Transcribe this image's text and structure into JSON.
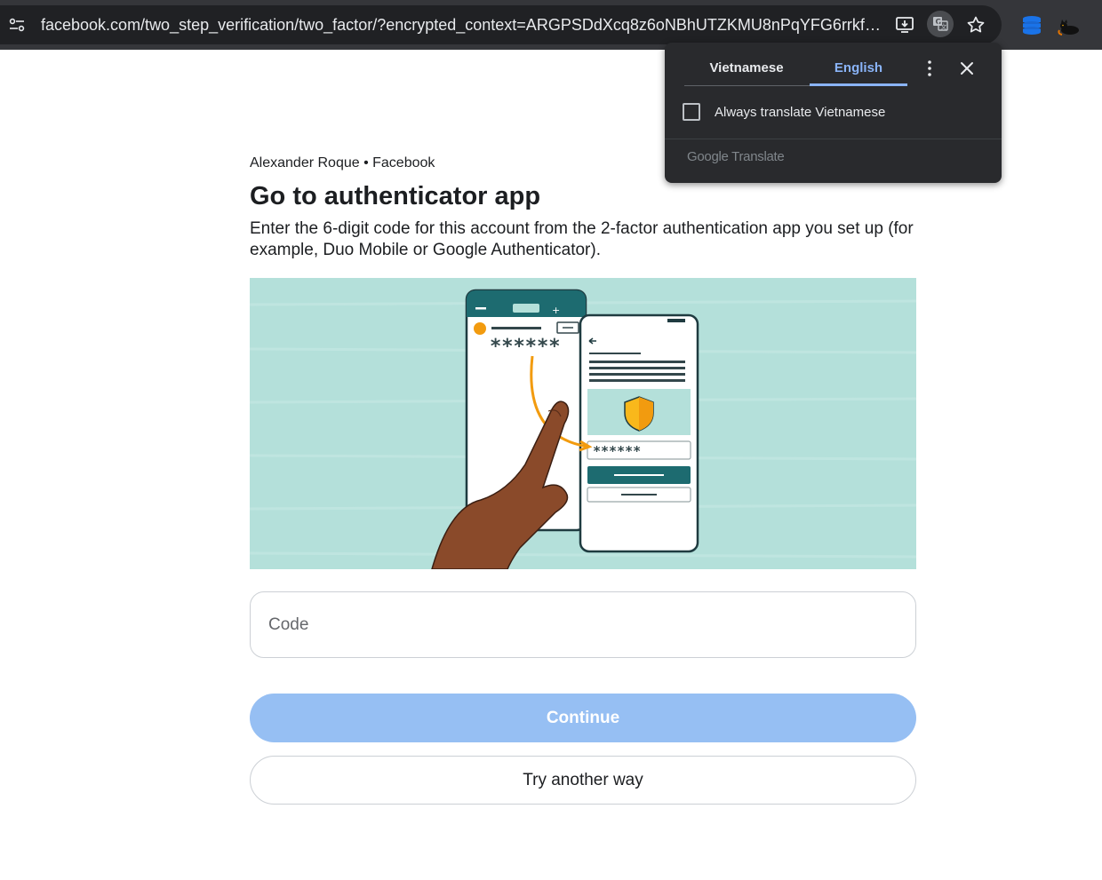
{
  "browser": {
    "url": "facebook.com/two_step_verification/two_factor/?encrypted_context=ARGPSDdXcq8z6oNBhUTZKMU8nPqYFG6rrkfXU3U5..."
  },
  "translate_popup": {
    "source_language": "Vietnamese",
    "target_language": "English",
    "always_translate_label": "Always translate Vietnamese",
    "brand": "Google Translate"
  },
  "page": {
    "account_line": "Alexander Roque • Facebook",
    "title": "Go to authenticator app",
    "description": "Enter the 6-digit code for this account from the 2-factor authentication app you set up (for example, Duo Mobile or Google Authenticator).",
    "code_placeholder": "Code",
    "continue_label": "Continue",
    "try_another_label": "Try another way",
    "illustration_code_masked": "******"
  },
  "colors": {
    "continue_disabled_bg": "#96bff3",
    "illustration_bg": "#b4e0da",
    "translate_active_tab": "#8ab4f8"
  }
}
